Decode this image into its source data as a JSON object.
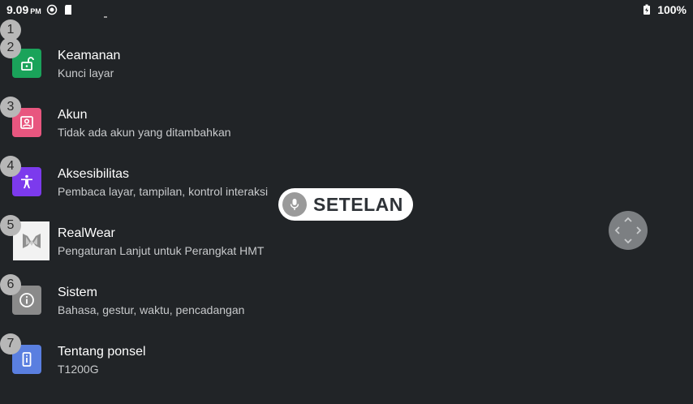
{
  "status_bar": {
    "time": "9.09",
    "ampm": "PM",
    "battery": "100%"
  },
  "settings": {
    "items": [
      {
        "number": "2",
        "title": "Keamanan",
        "subtitle": "Kunci layar",
        "icon": "lock-open-icon",
        "color": "#1aa35a"
      },
      {
        "number": "3",
        "title": "Akun",
        "subtitle": "Tidak ada akun yang ditambahkan",
        "icon": "account-box-icon",
        "color": "#e8567f"
      },
      {
        "number": "4",
        "title": "Aksesibilitas",
        "subtitle": "Pembaca layar, tampilan, kontrol interaksi",
        "icon": "accessibility-icon",
        "color": "#7c3aed"
      },
      {
        "number": "5",
        "title": "RealWear",
        "subtitle": "Pengaturan Lanjut untuk Perangkat HMT",
        "icon": "realwear-logo",
        "color": "#f2f2f2"
      },
      {
        "number": "6",
        "title": "Sistem",
        "subtitle": "Bahasa, gestur, waktu, pencadangan",
        "icon": "info-icon",
        "color": "#8a8a8a"
      },
      {
        "number": "7",
        "title": "Tentang ponsel",
        "subtitle": "T1200G",
        "icon": "phone-info-icon",
        "color": "#5a7fe0"
      }
    ],
    "first_number": "1"
  },
  "voice": {
    "label": "SETELAN"
  }
}
